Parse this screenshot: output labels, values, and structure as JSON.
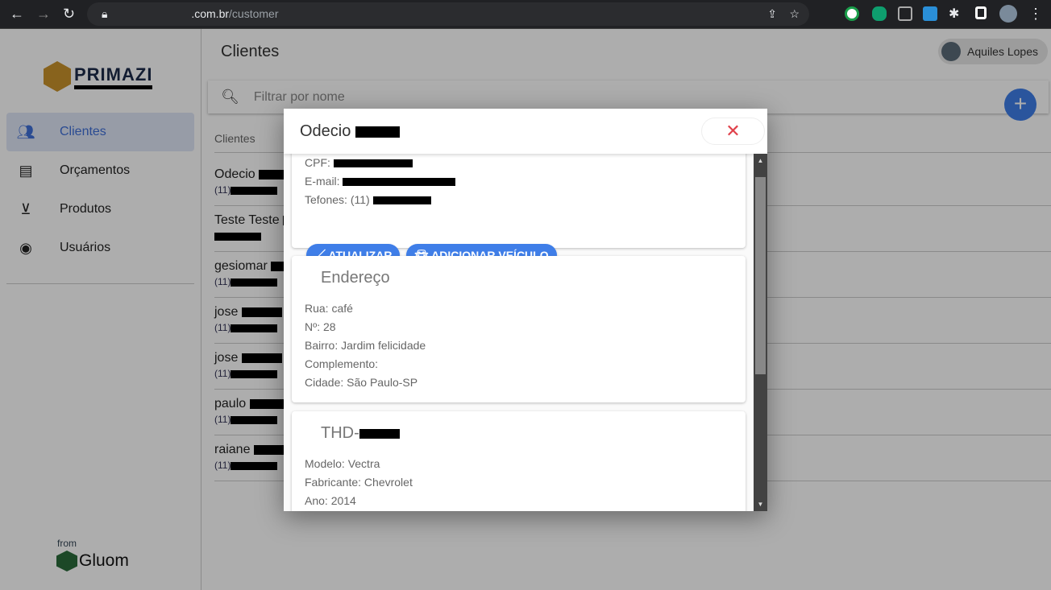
{
  "browser": {
    "url_domain": ".com.br",
    "url_path": "/customer"
  },
  "sidebar": {
    "logo": "PRIMAZI",
    "items": [
      {
        "label": "Clientes",
        "icon": "people-icon"
      },
      {
        "label": "Orçamentos",
        "icon": "document-icon"
      },
      {
        "label": "Produtos",
        "icon": "archive-icon"
      },
      {
        "label": "Usuários",
        "icon": "account-circle-icon"
      }
    ],
    "footer_from": "from",
    "footer_brand": "Gluom"
  },
  "header": {
    "title": "Clientes",
    "user": "Aquiles Lopes"
  },
  "search": {
    "placeholder": "Filtrar por nome"
  },
  "list": {
    "header": "Clientes",
    "rows": [
      {
        "name": "Odecio",
        "phone": "(11)"
      },
      {
        "name": "Teste Teste",
        "phone": ""
      },
      {
        "name": "gesiomar",
        "phone": "(11)"
      },
      {
        "name": "jose",
        "phone": "(11)"
      },
      {
        "name": "jose",
        "phone": "(11)"
      },
      {
        "name": "paulo",
        "phone": "(11)"
      },
      {
        "name": "raiane",
        "phone": "(11)"
      }
    ]
  },
  "modal": {
    "title": "Odecio",
    "cpf_label": "CPF:",
    "email_label": "E-mail:",
    "phones_label": "Tefones: (11)",
    "update_button": "ATUALIZAR",
    "add_vehicle_button": "ADICIONAR VEÍCULO",
    "address": {
      "title": "Endereço",
      "rua": "Rua: café",
      "numero": "Nº: 28",
      "bairro": "Bairro: Jardim felicidade",
      "complemento": "Complemento:",
      "cidade": "Cidade: São Paulo-SP"
    },
    "vehicle": {
      "title": "THD-",
      "modelo": "Modelo: Vectra",
      "fabricante": "Fabricante: Chevrolet",
      "ano": "Ano: 2014"
    }
  }
}
